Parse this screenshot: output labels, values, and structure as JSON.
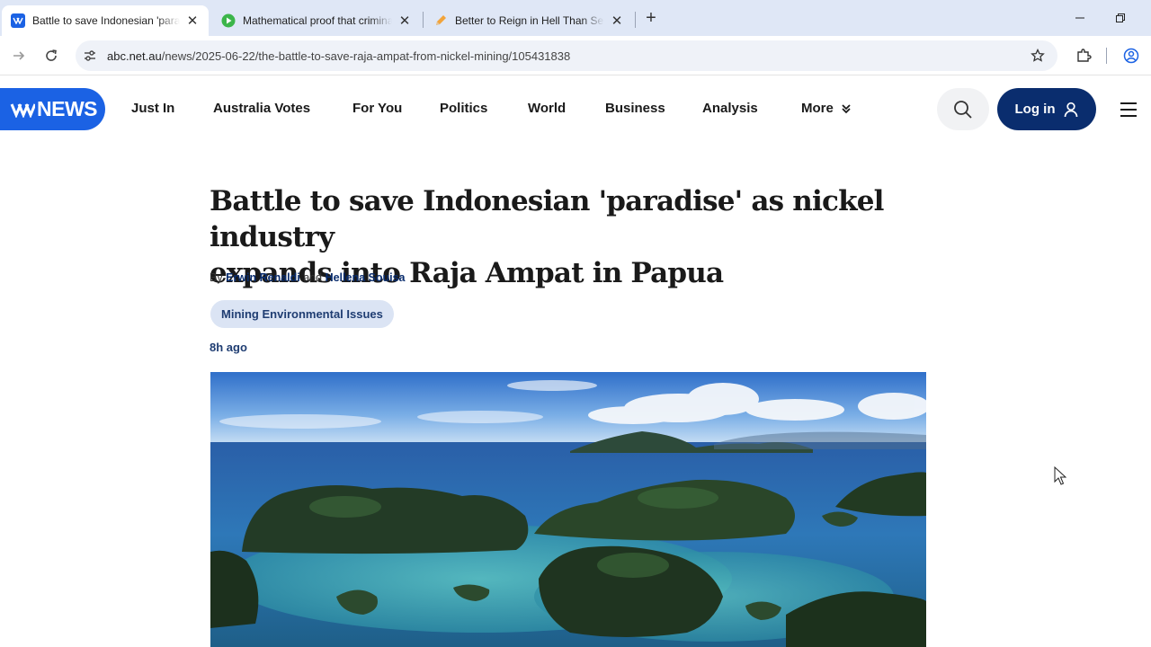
{
  "browser": {
    "tabs": [
      {
        "title": "Battle to save Indonesian 'paradise' as nickel industry",
        "active": true,
        "favicon": "abc-news-icon"
      },
      {
        "title": "Mathematical proof that criminals",
        "active": false,
        "favicon": "play-icon"
      },
      {
        "title": "Better to Reign in Hell Than Serve",
        "active": false,
        "favicon": "pencil-icon"
      }
    ],
    "url_host": "abc.net.au",
    "url_path": "/news/2025-06-22/the-battle-to-save-raja-ampat-from-nickel-mining/105431838"
  },
  "site": {
    "logo_text": "NEWS",
    "nav": [
      "Just In",
      "Australia Votes",
      "For You",
      "Politics",
      "World",
      "Business",
      "Analysis",
      "More"
    ],
    "login_label": "Log in"
  },
  "article": {
    "headline_line1": "Battle to save Indonesian 'paradise' as nickel industry",
    "headline_line2": "expands into Raja Ampat in Papua",
    "by": "By",
    "author1": "Erwin Renaldi",
    "and": "and",
    "author2": "Hellena Souisa",
    "tag": "Mining Environmental Issues",
    "time": "8h ago"
  },
  "colors": {
    "brand_blue": "#1b62e4",
    "login_navy": "#0a2d6e",
    "tab_strip": "#dfe7f6"
  }
}
